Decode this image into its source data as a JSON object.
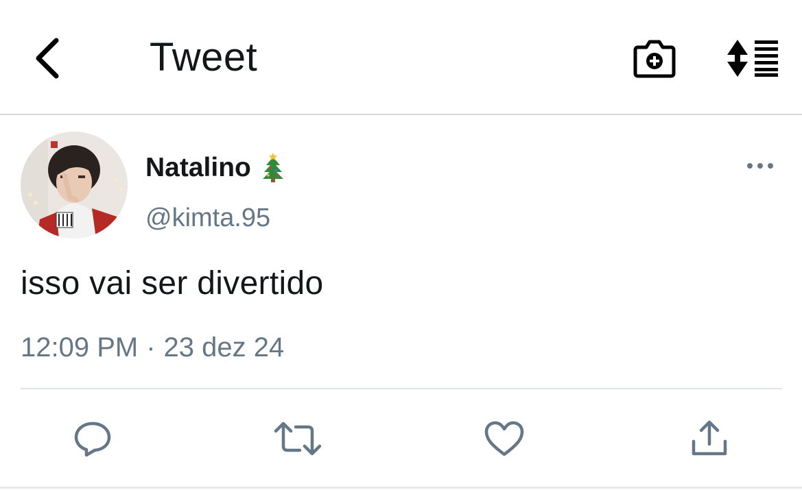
{
  "header": {
    "title": "Tweet",
    "back_icon": "chevron-left-icon",
    "camera_icon": "camera-plus-icon",
    "sort_icon": "sort-list-icon"
  },
  "tweet": {
    "display_name": "Natalino",
    "name_emoji": "christmas-tree-emoji",
    "handle": "@kimta.95",
    "text": "isso vai ser divertido",
    "time": "12:09 PM",
    "separator": "·",
    "date": "23 dez 24",
    "more_icon": "more-horizontal-icon"
  },
  "actions": [
    {
      "name": "reply",
      "icon": "reply-icon"
    },
    {
      "name": "retweet",
      "icon": "retweet-icon"
    },
    {
      "name": "like",
      "icon": "heart-icon"
    },
    {
      "name": "share",
      "icon": "share-icon"
    }
  ],
  "colors": {
    "text_primary": "#14171a",
    "text_secondary": "#657786",
    "divider": "#e1e4e6"
  }
}
